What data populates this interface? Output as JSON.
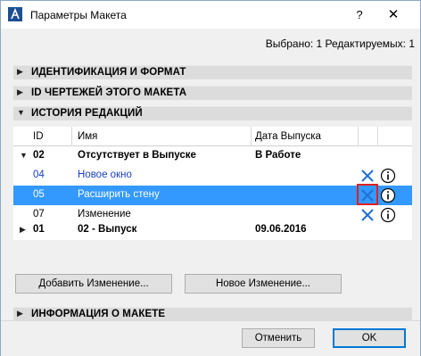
{
  "window": {
    "title": "Параметры Макета",
    "help_glyph": "?",
    "close_glyph": "✕"
  },
  "status": {
    "text": "Выбрано: 1 Редактируемых: 1"
  },
  "sections": {
    "identification": {
      "label": "ИДЕНТИФИКАЦИЯ И ФОРМАТ",
      "expanded": false
    },
    "drawing_ids": {
      "label": "ID ЧЕРТЕЖЕЙ ЭТОГО МАКЕТА",
      "expanded": false
    },
    "revision_history": {
      "label": "ИСТОРИЯ РЕДАКЦИЙ",
      "expanded": true
    },
    "layout_info": {
      "label": "ИНФОРМАЦИЯ О МАКЕТЕ",
      "expanded": false
    }
  },
  "table": {
    "headers": {
      "id": "ID",
      "name": "Имя",
      "date": "Дата Выпуска"
    },
    "rows": [
      {
        "id": "02",
        "name": "Отсутствует в Выпуске",
        "date": "В Работе",
        "type": "group",
        "expanded": true
      },
      {
        "id": "04",
        "name": "Новое окно",
        "date": "",
        "type": "change",
        "style": "blue"
      },
      {
        "id": "05",
        "name": "Расширить стену",
        "date": "",
        "type": "change",
        "style": "selected"
      },
      {
        "id": "07",
        "name": "Изменение",
        "date": "",
        "type": "change",
        "style": "normal"
      },
      {
        "id": "01",
        "name": "02 - Выпуск",
        "date": "09.06.2016",
        "type": "group",
        "expanded": false
      }
    ]
  },
  "buttons": {
    "add_change": "Добавить Изменение...",
    "new_change": "Новое Изменение...",
    "cancel": "Отменить",
    "ok": "OK"
  },
  "colors": {
    "selection": "#3399ff",
    "delete_icon": "#1f6fd1",
    "highlight_box": "#e02020",
    "blue_text": "#1a3fc0"
  },
  "icons": {
    "delete": "close-x-icon",
    "info": "info-circle-icon",
    "collapsed": "triangle-right-icon",
    "expanded": "triangle-down-icon"
  }
}
